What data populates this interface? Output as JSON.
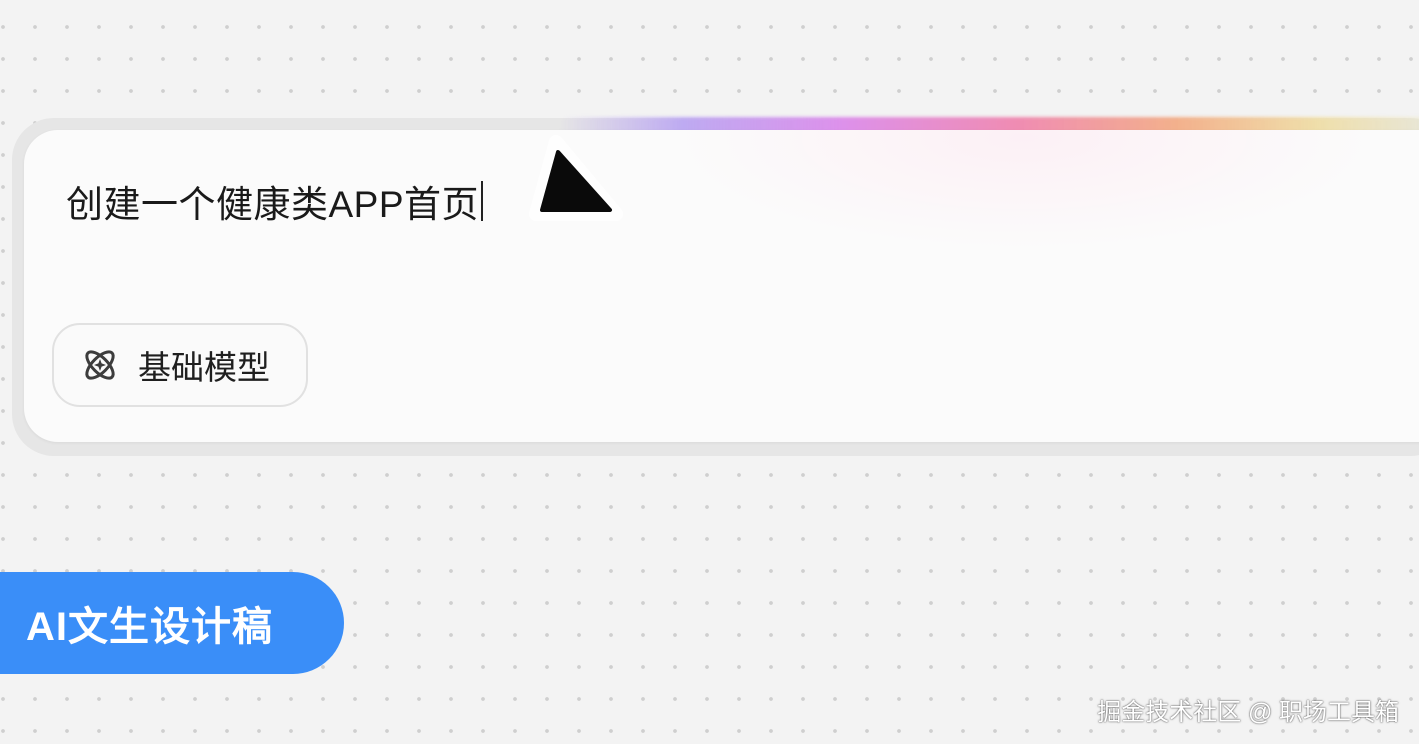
{
  "prompt_box": {
    "text": "创建一个健康类APP首页"
  },
  "model_selector": {
    "label": "基础模型",
    "icon": "atom-icon"
  },
  "feature_badge": {
    "label": "AI文生设计稿"
  },
  "watermark": {
    "text": "掘金技术社区 @ 职场工具箱"
  },
  "colors": {
    "badge": "#3a8ef8",
    "background": "#f3f3f3",
    "panel": "#fbfbfb"
  }
}
